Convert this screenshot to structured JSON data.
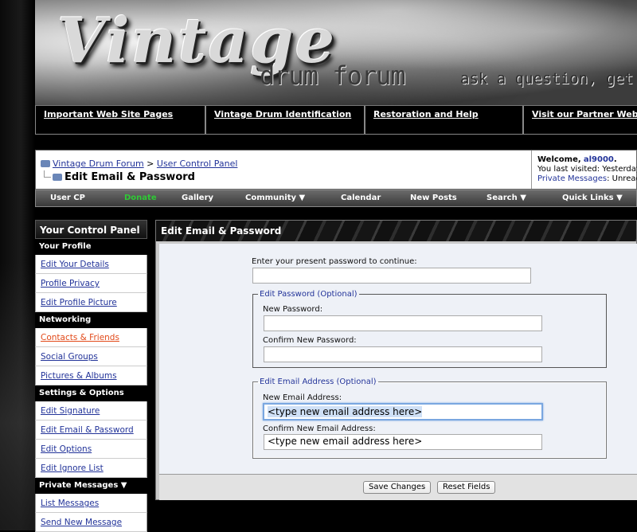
{
  "banner": {
    "logo": "Vintage",
    "subtitle": "drum forum",
    "tagline": "ask a question, get an answer"
  },
  "top_links": [
    "Important Web Site Pages",
    "Vintage Drum Identification",
    "Restoration and Help",
    "Visit our Partner Web Sites"
  ],
  "breadcrumb": {
    "home": "Vintage Drum Forum",
    "separator": ">",
    "section": "User Control Panel",
    "title": "Edit Email & Password"
  },
  "welcome": {
    "welcome_label": "Welcome,",
    "username": "al9000",
    "period": ".",
    "last_visit": "You last visited: Yesterday",
    "pm_link": "Private Messages",
    "pm_status": ": Unread"
  },
  "navbar": {
    "user_cp": "User CP",
    "donate": "Donate",
    "gallery": "Gallery",
    "community": "Community ▼",
    "calendar": "Calendar",
    "new_posts": "New Posts",
    "search": "Search ▼",
    "quick_links": "Quick Links ▼"
  },
  "sidebar": {
    "title": "Your Control Panel",
    "sections": [
      {
        "label": "Your Profile",
        "items": [
          "Edit Your Details",
          "Profile Privacy",
          "Edit Profile Picture"
        ]
      },
      {
        "label": "Networking",
        "items": [
          "Contacts & Friends",
          "Social Groups",
          "Pictures & Albums"
        ]
      },
      {
        "label": "Settings & Options",
        "items": [
          "Edit Signature",
          "Edit Email & Password",
          "Edit Options",
          "Edit Ignore List"
        ]
      },
      {
        "label": "Private Messages ▼",
        "items": [
          "List Messages",
          "Send New Message"
        ]
      }
    ]
  },
  "panel": {
    "title": "Edit Email & Password",
    "present_password_label": "Enter your present password to continue:",
    "present_password_value": "",
    "password_legend": "Edit Password (Optional)",
    "new_password_label": "New Password:",
    "new_password_value": "",
    "confirm_password_label": "Confirm New Password:",
    "confirm_password_value": "",
    "email_legend": "Edit Email Address (Optional)",
    "new_email_label": "New Email Address:",
    "new_email_value": "<type new email address here>",
    "confirm_email_label": "Confirm New Email Address:",
    "confirm_email_value": "<type new email address here>",
    "save_button": "Save Changes",
    "reset_button": "Reset Fields"
  },
  "colors": {
    "link": "#223399",
    "active_link": "#e24a1a",
    "donate": "#2fc936",
    "panel_bg": "#eef1f7"
  }
}
